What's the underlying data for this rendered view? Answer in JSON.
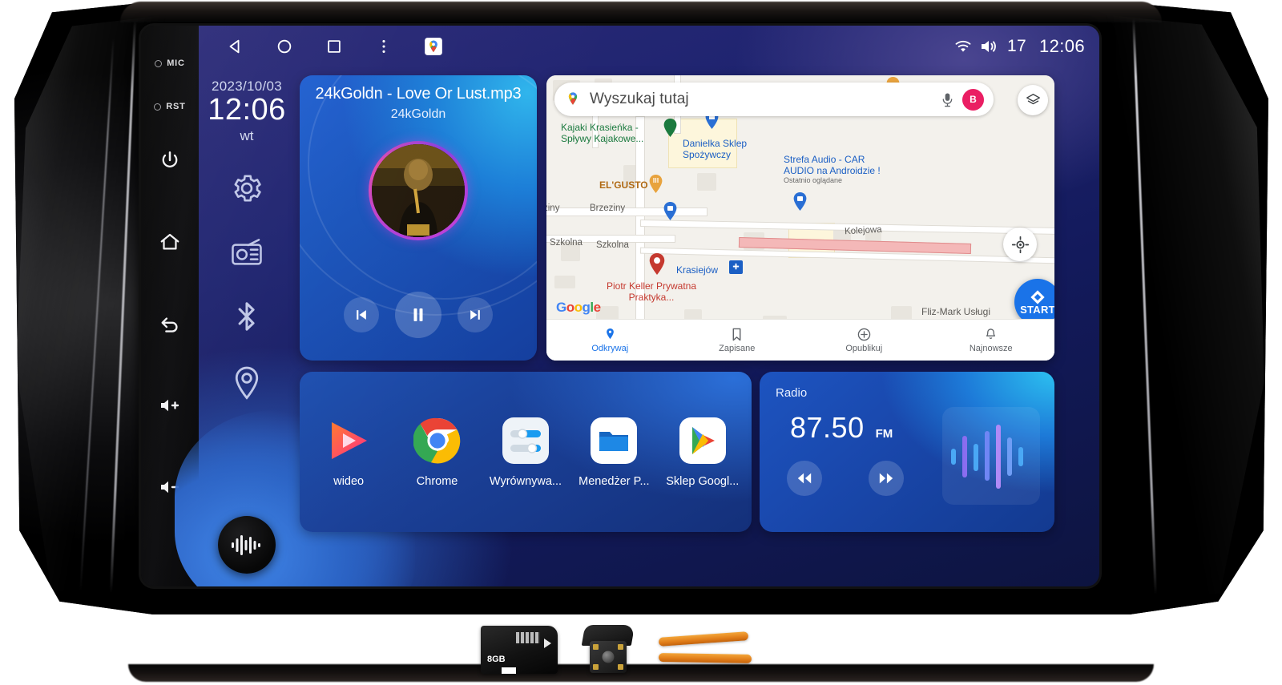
{
  "device": {
    "hardware_labels": {
      "mic": "MIC",
      "reset": "RST"
    },
    "hardware_buttons": [
      {
        "name": "power",
        "icon": "power-icon"
      },
      {
        "name": "home",
        "icon": "home-icon"
      },
      {
        "name": "back",
        "icon": "back-icon"
      },
      {
        "name": "volume-up",
        "icon": "volume-up-icon"
      },
      {
        "name": "volume-down",
        "icon": "volume-down-icon"
      }
    ]
  },
  "statusbar": {
    "nav": [
      {
        "name": "back",
        "icon": "triangle-back-icon"
      },
      {
        "name": "home",
        "icon": "circle-home-icon"
      },
      {
        "name": "recents",
        "icon": "square-recents-icon"
      },
      {
        "name": "overflow",
        "icon": "kebab-menu-icon"
      },
      {
        "name": "maps-shortcut",
        "icon": "google-maps-icon"
      }
    ],
    "wifi_icon": "wifi-icon",
    "volume_icon": "speaker-icon",
    "volume_level": "17",
    "clock": "12:06"
  },
  "datetime_widget": {
    "date": "2023/10/03",
    "time": "12:06",
    "weekday": "wt"
  },
  "quick_column": [
    {
      "name": "settings",
      "icon": "gear-icon"
    },
    {
      "name": "radio",
      "icon": "radio-icon"
    },
    {
      "name": "bluetooth",
      "icon": "bluetooth-icon"
    },
    {
      "name": "navigation",
      "icon": "location-pin-icon"
    }
  ],
  "voice_assistant": {
    "icon": "waveform-icon"
  },
  "music": {
    "title": "24kGoldn - Love Or Lust.mp3",
    "artist": "24kGoldn",
    "album_art": "album-art-24kgoldn",
    "controls": [
      {
        "name": "previous",
        "icon": "skip-previous-icon"
      },
      {
        "name": "pause",
        "icon": "pause-icon"
      },
      {
        "name": "next",
        "icon": "skip-next-icon"
      }
    ]
  },
  "maps": {
    "search_placeholder": "Wyszukaj tutaj",
    "mic_icon": "microphone-icon",
    "avatar_initial": "B",
    "layers_icon": "layers-icon",
    "my_location_icon": "my-location-icon",
    "start_button": "START",
    "attribution": "Google",
    "pois": [
      {
        "name": "Kajaki Krasieńka - Spływy Kajakowe...",
        "color": "#1b7a3f"
      },
      {
        "name": "Danielka Sklep Spożywczy",
        "color": "#1b5fc4"
      },
      {
        "name": "Strefa Audio - CAR AUDIO na Androidzie !",
        "sub": "Ostatnio oglądane",
        "color": "#1b5fc4"
      },
      {
        "name": "EL'GUSTO",
        "color": "#b06a14"
      },
      {
        "name": "Piotr Keller Prywatna Praktyka...",
        "color": "#c5392f"
      },
      {
        "name": "Krasiejów",
        "color": "#1b5fc4"
      },
      {
        "name": "Fliz-Mark Usługi Glazurnicze",
        "color": "#5d5b57"
      }
    ],
    "streets": [
      "ziny",
      "Brzeziny",
      "Szkolna",
      "Szkolna",
      "Kolejowa"
    ],
    "bottom_nav": [
      {
        "label": "Odkrywaj",
        "icon": "explore-pin-icon",
        "active": true
      },
      {
        "label": "Zapisane",
        "icon": "bookmark-icon",
        "active": false
      },
      {
        "label": "Opublikuj",
        "icon": "plus-circle-icon",
        "active": false
      },
      {
        "label": "Najnowsze",
        "icon": "bell-icon",
        "active": false
      }
    ]
  },
  "apps": [
    {
      "label": "wideo",
      "icon": "video-player-icon"
    },
    {
      "label": "Chrome",
      "icon": "chrome-icon"
    },
    {
      "label": "Wyrównywa...",
      "icon": "equalizer-icon"
    },
    {
      "label": "Menedżer P...",
      "icon": "file-manager-icon"
    },
    {
      "label": "Sklep Googl...",
      "icon": "google-play-icon"
    }
  ],
  "radio": {
    "title": "Radio",
    "frequency": "87.50",
    "band": "FM",
    "controls": [
      {
        "name": "seek-backward",
        "icon": "rewind-icon"
      },
      {
        "name": "seek-forward",
        "icon": "fast-forward-icon"
      }
    ],
    "visualizer_icon": "audio-bars-icon"
  },
  "accessories": [
    {
      "name": "microsd-card",
      "capacity": "8GB"
    },
    {
      "name": "rear-camera"
    },
    {
      "name": "pry-tools"
    }
  ],
  "colors": {
    "accent_blue": "#1a73e8",
    "ui_blue": "#1d54c0",
    "status_pink": "#ea1e63",
    "viz_purple": "#7b5cf0"
  }
}
